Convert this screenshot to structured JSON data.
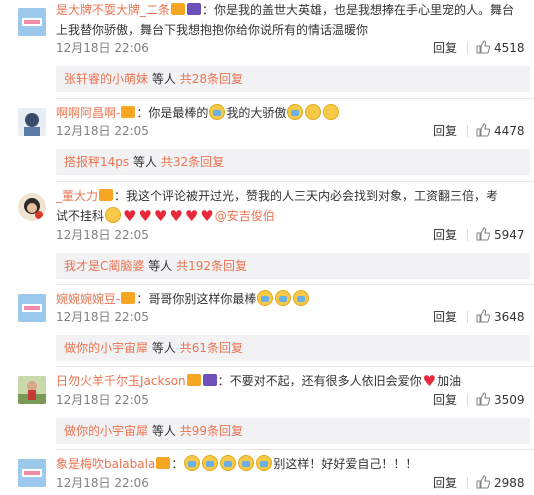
{
  "comments": [
    {
      "username": "是大牌不耍大牌_二条",
      "text_lines": [
        "：你是我的盖世大英雄，也是我想捧在手心里宠的人。舞台",
        "上我替你骄傲，舞台下我想抱抱你给你说所有的情话温暖你"
      ],
      "time": "12月18日 22:06",
      "reply_label": "回复",
      "likes": "4518",
      "sub_user": "张轩睿的小萌妹",
      "sub_mid": "等人",
      "sub_total": "共28条回复"
    },
    {
      "username": "啊啊阿昌啊-",
      "text_before": "：你是最棒的",
      "text_mid": "我的大骄傲",
      "time": "12月18日 22:05",
      "reply_label": "回复",
      "likes": "4478",
      "sub_user": "搭报秤14ps",
      "sub_mid": "等人",
      "sub_total": "共32条回复"
    },
    {
      "username": "_董大力",
      "text_line1": "：我这个评论被开过光，赞我的人三天内必会找到对象，工资翻三倍，考",
      "text_line2": "试不挂科",
      "mention": "@安吉俊伯",
      "time": "12月18日 22:05",
      "reply_label": "回复",
      "likes": "5947",
      "sub_user": "我才是C蔺脑婆",
      "sub_mid": "等人",
      "sub_total": "共192条回复"
    },
    {
      "username": "婉婉婉婉豆-",
      "text": "：哥哥你别这样你最棒",
      "time": "12月18日 22:05",
      "reply_label": "回复",
      "likes": "3648",
      "sub_user": "做你的小宇宙犀",
      "sub_mid": "等人",
      "sub_total": "共61条回复"
    },
    {
      "username": "日勿火羊千尔玉Jackson",
      "text": "：不要对不起，还有很多人依旧会爱你",
      "text_after": "加油",
      "time": "12月18日 22:05",
      "reply_label": "回复",
      "likes": "3509",
      "sub_user": "做你的小宇宙犀",
      "sub_mid": "等人",
      "sub_total": "共99条回复"
    },
    {
      "username": "象是梅吹balabala",
      "text_before": "：",
      "text_after": "别这样！好好爱自己！！！",
      "time": "12月18日 22:06",
      "reply_label": "回复",
      "likes": "2988"
    }
  ],
  "colors": {
    "username": "#eb7350",
    "meta": "#808080",
    "subbox": "#f2f2f5",
    "heart": "#e8283c"
  }
}
